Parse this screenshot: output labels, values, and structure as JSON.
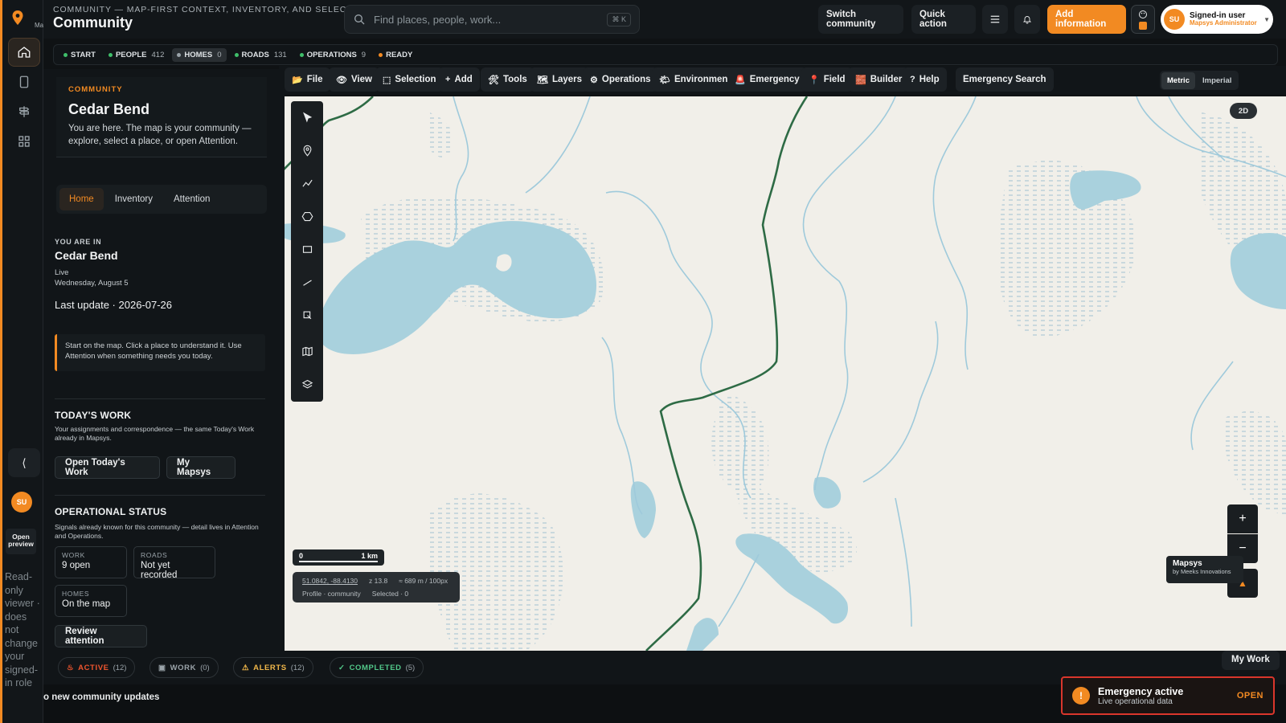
{
  "app": {
    "subtitle": "COMMUNITY — MAP-FIRST CONTEXT, INVENTORY, AND SELECTION.",
    "title": "Community",
    "logo_text": "Ma"
  },
  "search": {
    "placeholder": "Find places, people, work...",
    "shortcut": "⌘ K"
  },
  "header_buttons": {
    "switch_community": "Switch community",
    "quick_action": "Quick action",
    "add_information": "Add information"
  },
  "user": {
    "initials": "SU",
    "name": "Signed-in user",
    "role": "Mapsys Administrator"
  },
  "status_pills": [
    {
      "label": "START",
      "count": "",
      "color": "#3fbf6a"
    },
    {
      "label": "PEOPLE",
      "count": "412",
      "color": "#3fbf6a"
    },
    {
      "label": "HOMES",
      "count": "0",
      "color": "#9aa3a9"
    },
    {
      "label": "ROADS",
      "count": "131",
      "color": "#3fbf6a"
    },
    {
      "label": "OPERATIONS",
      "count": "9",
      "color": "#3fbf6a"
    },
    {
      "label": "READY",
      "count": "",
      "color": "#f28a22"
    }
  ],
  "panel": {
    "eyebrow": "COMMUNITY",
    "name": "Cedar Bend",
    "intro": "You are here. The map is your community — explore, select a place, or open Attention.",
    "tabs": [
      "Home",
      "Inventory",
      "Attention"
    ],
    "you_are_in_label": "YOU ARE IN",
    "location": "Cedar Bend",
    "mode": "Live",
    "date": "Wednesday, August 5",
    "last_update": "Last update · 2026-07-26",
    "note": "Start on the map. Click a place to understand it. Use Attention when something needs you today.",
    "todays_work_title": "TODAY'S WORK",
    "todays_work_desc": "Your assignments and correspondence — the same Today's Work already in Mapsys.",
    "open_todays_work": "Open Today's Work",
    "my_mapsys": "My Mapsys",
    "op_status_title": "OPERATIONAL STATUS",
    "op_status_desc": "Signals already known for this community — detail lives in Attention and Operations.",
    "stats": [
      {
        "key": "WORK",
        "value": "9 open"
      },
      {
        "key": "ROADS",
        "value": "Not yet recorded"
      },
      {
        "key": "HOMES",
        "value": "On the map"
      }
    ],
    "review_attention": "Review attention"
  },
  "rail": {
    "collapse": "⟨",
    "initials": "SU",
    "open_preview": "Open preview",
    "readonly_note": "Read-only viewer · does not change your signed-in role"
  },
  "menu": [
    {
      "icon": "📂",
      "label": "File"
    },
    {
      "icon": "👁",
      "label": "View"
    },
    {
      "icon": "⬚",
      "label": "Selection"
    },
    {
      "icon": "+",
      "label": "Add"
    },
    {
      "icon": "🛠",
      "label": "Tools"
    },
    {
      "icon": "🗺",
      "label": "Layers"
    },
    {
      "icon": "⚙",
      "label": "Operations"
    },
    {
      "icon": "🌤",
      "label": "Environment"
    },
    {
      "icon": "🚨",
      "label": "Emergency"
    },
    {
      "icon": "📍",
      "label": "Field"
    },
    {
      "icon": "🧱",
      "label": "Builder"
    },
    {
      "icon": "?",
      "label": "Help"
    }
  ],
  "emergency_search": "Emergency Search",
  "units": {
    "metric": "Metric",
    "imperial": "Imperial"
  },
  "map": {
    "mode_badge": "2D",
    "scale_start": "0",
    "scale_end": "1 km",
    "coords": "51.0842, -88.4130",
    "zoom": "z 13.8",
    "resolution": "≈ 689 m / 100px",
    "profile": "Profile · community",
    "selected": "Selected · 0",
    "attribution_title": "Mapsys",
    "attribution_sub": "by Meeks Innovations",
    "zoom_in": "+",
    "zoom_out": "−",
    "north": "▲"
  },
  "tray": [
    {
      "label": "ACTIVE",
      "count": "(12)",
      "color": "#f0552e"
    },
    {
      "label": "WORK",
      "count": "(0)",
      "color": "#9aa3a9"
    },
    {
      "label": "ALERTS",
      "count": "(12)",
      "color": "#f2b84a"
    },
    {
      "label": "COMPLETED",
      "count": "(5)",
      "color": "#52c98a"
    }
  ],
  "my_work": "My Work",
  "footer_text": "o new community updates",
  "emergency": {
    "title": "Emergency active",
    "subtitle": "Live operational data",
    "action": "OPEN"
  }
}
